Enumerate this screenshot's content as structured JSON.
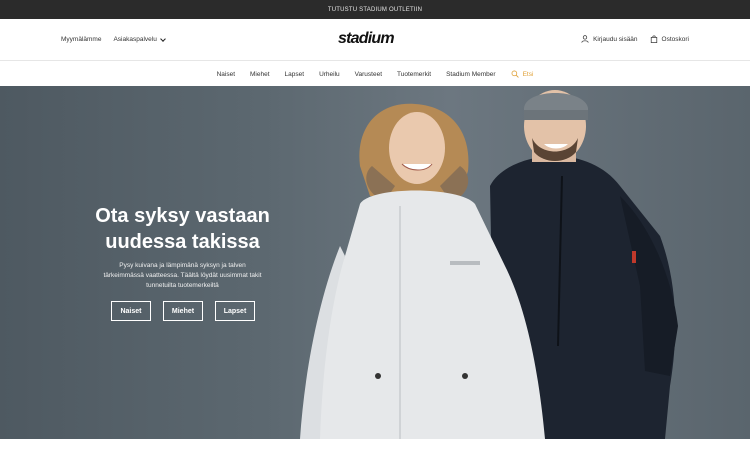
{
  "promo": {
    "text": "TUTUSTU STADIUM OUTLETIIN"
  },
  "header": {
    "stores_label": "Myymälämme",
    "service_label": "Asiakaspalvelu",
    "logo_text": "stadium",
    "login_label": "Kirjaudu sisään",
    "cart_label": "Ostoskori"
  },
  "nav": {
    "items": [
      "Naiset",
      "Miehet",
      "Lapset",
      "Urheilu",
      "Varusteet",
      "Tuotemerkit",
      "Stadium Member"
    ],
    "search_label": "Etsi"
  },
  "hero": {
    "title_line1": "Ota syksy vastaan",
    "title_line2": "uudessa takissa",
    "subtitle_line1": "Pysy kuivana ja lämpimänä syksyn ja talven",
    "subtitle_line2": "tärkeimmässä vaatteessa. Täältä löydät uusimmat takit",
    "subtitle_line3": "tunnetuilta tuotemerkeiltä",
    "buttons": [
      "Naiset",
      "Miehet",
      "Lapset"
    ]
  },
  "colors": {
    "promo_bg": "#2b2b2b",
    "hero_bg": "#5c6870",
    "search_accent": "#e0a23a"
  },
  "icons": {
    "login": "user-icon",
    "cart": "bag-icon",
    "search": "search-icon",
    "service": "chevron-down-icon"
  }
}
